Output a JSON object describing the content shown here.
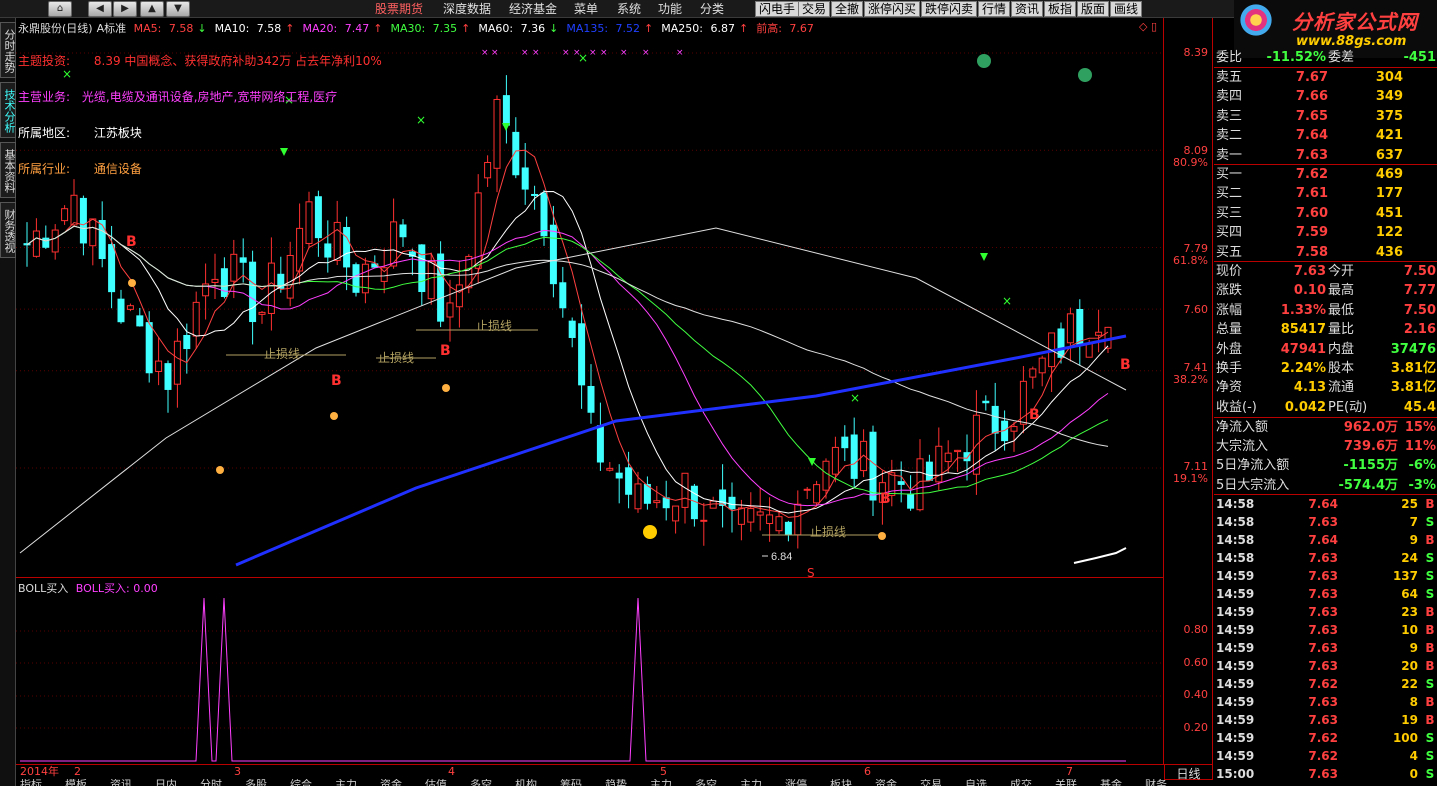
{
  "toolbar": {
    "nav_buttons": [
      "⌂",
      "◀",
      "▶",
      "▲",
      "▼"
    ],
    "menus": [
      "股票期货",
      "深度数据",
      "经济基金",
      "菜单",
      "系统",
      "功能",
      "分类"
    ],
    "buttons": [
      "闪电手",
      "交易",
      "全撤",
      "涨停闪买",
      "跌停闪卖",
      "行情",
      "资讯",
      "板指",
      "版面",
      "画线"
    ]
  },
  "logo": {
    "title": "分析家公式网",
    "url": "www.88gs.com"
  },
  "left_tabs": [
    "分时走势",
    "技术分析",
    "基本资料",
    "财务透视"
  ],
  "chart": {
    "title": "永鼎股份(日线)",
    "mode": "A标准",
    "ma": [
      {
        "label": "MA5:",
        "value": "7.58",
        "arrow": "↓",
        "color": "#ff4040"
      },
      {
        "label": "MA10:",
        "value": "7.58",
        "arrow": "↑",
        "color": "#ffffff"
      },
      {
        "label": "MA20:",
        "value": "7.47",
        "arrow": "↑",
        "color": "#ff40ff"
      },
      {
        "label": "MA30:",
        "value": "7.35",
        "arrow": "↑",
        "color": "#40ff40"
      },
      {
        "label": "MA60:",
        "value": "7.36",
        "arrow": "↓",
        "color": "#ffffff"
      },
      {
        "label": "MA135:",
        "value": "7.52",
        "arrow": "↑",
        "color": "#2040ff"
      },
      {
        "label": "MA250:",
        "value": "6.87",
        "arrow": "↑",
        "color": "#ffffff"
      },
      {
        "label": "前高:",
        "value": "7.67",
        "arrow": "",
        "color": "#ff4040"
      }
    ],
    "info": [
      {
        "label": "主题投资:",
        "text": "8.39 中国概念、获得政府补助342万 占去年净利10%",
        "color": "#ff3030"
      },
      {
        "label": "主营业务:",
        "text": "光缆,电缆及通讯设备,房地产,宽带网络工程,医疗",
        "color": "#ff40ff"
      },
      {
        "label": "所属地区:",
        "text": "江苏板块",
        "color": "#ffffff"
      },
      {
        "label": "所属行业:",
        "text": "通信设备",
        "color": "#ffa040"
      }
    ],
    "price_ticks": [
      "8.39",
      "8.09",
      "7.79",
      "7.60",
      "7.41",
      "7.11"
    ],
    "pct_ticks": [
      "80.9%",
      "61.8%",
      "38.2%",
      "19.1%"
    ],
    "low_label": "6.84",
    "stoploss_label": "止损线",
    "buy_mark": "B",
    "sell_mark": "S"
  },
  "subchart": {
    "name": "BOLL买入",
    "value_label": "BOLL买入: 0.00",
    "ticks": [
      "0.80",
      "0.60",
      "0.40",
      "0.20"
    ]
  },
  "date_axis": {
    "year": "2014年",
    "months": [
      "2",
      "3",
      "4",
      "5",
      "6",
      "7"
    ],
    "period": "日线"
  },
  "bottom_tabs": [
    "指标",
    "模板",
    "资讯",
    "日内",
    "分时",
    "多股",
    "综合",
    "主力",
    "资金",
    "估值",
    "多空",
    "机构",
    "筹码",
    "趋势",
    "主力",
    "多空",
    "主力",
    "涨停",
    "板块",
    "资金",
    "交易",
    "自选",
    "成交",
    "关联",
    "基金",
    "财务"
  ],
  "orderbook": {
    "ratio_label": "委比",
    "ratio_value": "-11.52%",
    "diff_label": "委差",
    "diff_value": "-451",
    "asks": [
      {
        "label": "卖五",
        "price": "7.67",
        "vol": "304"
      },
      {
        "label": "卖四",
        "price": "7.66",
        "vol": "349"
      },
      {
        "label": "卖三",
        "price": "7.65",
        "vol": "375"
      },
      {
        "label": "卖二",
        "price": "7.64",
        "vol": "421"
      },
      {
        "label": "卖一",
        "price": "7.63",
        "vol": "637"
      }
    ],
    "bids": [
      {
        "label": "买一",
        "price": "7.62",
        "vol": "469"
      },
      {
        "label": "买二",
        "price": "7.61",
        "vol": "177"
      },
      {
        "label": "买三",
        "price": "7.60",
        "vol": "451"
      },
      {
        "label": "买四",
        "price": "7.59",
        "vol": "122"
      },
      {
        "label": "买五",
        "price": "7.58",
        "vol": "436"
      }
    ]
  },
  "quote": [
    {
      "l1": "现价",
      "v1": "7.63",
      "c1": "#ff4040",
      "l2": "今开",
      "v2": "7.50",
      "c2": "#ff4040"
    },
    {
      "l1": "涨跌",
      "v1": "0.10",
      "c1": "#ff4040",
      "l2": "最高",
      "v2": "7.77",
      "c2": "#ff4040"
    },
    {
      "l1": "涨幅",
      "v1": "1.33%",
      "c1": "#ff4040",
      "l2": "最低",
      "v2": "7.50",
      "c2": "#ff4040"
    },
    {
      "l1": "总量",
      "v1": "85417",
      "c1": "#ffcc00",
      "l2": "量比",
      "v2": "2.16",
      "c2": "#ff4040"
    },
    {
      "l1": "外盘",
      "v1": "47941",
      "c1": "#ff4040",
      "l2": "内盘",
      "v2": "37476",
      "c2": "#40ff40"
    },
    {
      "l1": "换手",
      "v1": "2.24%",
      "c1": "#ffcc00",
      "l2": "股本",
      "v2": "3.81亿",
      "c2": "#ffcc00"
    },
    {
      "l1": "净资",
      "v1": "4.13",
      "c1": "#ffcc00",
      "l2": "流通",
      "v2": "3.81亿",
      "c2": "#ffcc00"
    },
    {
      "l1": "收益(-)",
      "v1": "0.042",
      "c1": "#ffcc00",
      "l2": "PE(动)",
      "v2": "45.4",
      "c2": "#ffcc00"
    }
  ],
  "flows": [
    {
      "label": "净流入额",
      "value": "962.0万",
      "pct": "15%",
      "color": "#ff4040"
    },
    {
      "label": "大宗流入",
      "value": "739.6万",
      "pct": "11%",
      "color": "#ff4040"
    },
    {
      "label": "5日净流入额",
      "value": "-1155万",
      "pct": "-6%",
      "color": "#40ff40"
    },
    {
      "label": "5日大宗流入",
      "value": "-574.4万",
      "pct": "-3%",
      "color": "#40ff40"
    }
  ],
  "ticks": [
    {
      "t": "14:58",
      "p": "7.64",
      "v": "25",
      "d": "B"
    },
    {
      "t": "14:58",
      "p": "7.63",
      "v": "7",
      "d": "S"
    },
    {
      "t": "14:58",
      "p": "7.64",
      "v": "9",
      "d": "B"
    },
    {
      "t": "14:58",
      "p": "7.63",
      "v": "24",
      "d": "S"
    },
    {
      "t": "14:59",
      "p": "7.63",
      "v": "137",
      "d": "S"
    },
    {
      "t": "14:59",
      "p": "7.63",
      "v": "64",
      "d": "S"
    },
    {
      "t": "14:59",
      "p": "7.63",
      "v": "23",
      "d": "B"
    },
    {
      "t": "14:59",
      "p": "7.63",
      "v": "10",
      "d": "B"
    },
    {
      "t": "14:59",
      "p": "7.63",
      "v": "9",
      "d": "B"
    },
    {
      "t": "14:59",
      "p": "7.63",
      "v": "20",
      "d": "B"
    },
    {
      "t": "14:59",
      "p": "7.62",
      "v": "22",
      "d": "S"
    },
    {
      "t": "14:59",
      "p": "7.63",
      "v": "8",
      "d": "B"
    },
    {
      "t": "14:59",
      "p": "7.63",
      "v": "19",
      "d": "B"
    },
    {
      "t": "14:59",
      "p": "7.62",
      "v": "100",
      "d": "S"
    },
    {
      "t": "14:59",
      "p": "7.62",
      "v": "4",
      "d": "S"
    },
    {
      "t": "15:00",
      "p": "7.63",
      "v": "0",
      "d": "S"
    }
  ]
}
